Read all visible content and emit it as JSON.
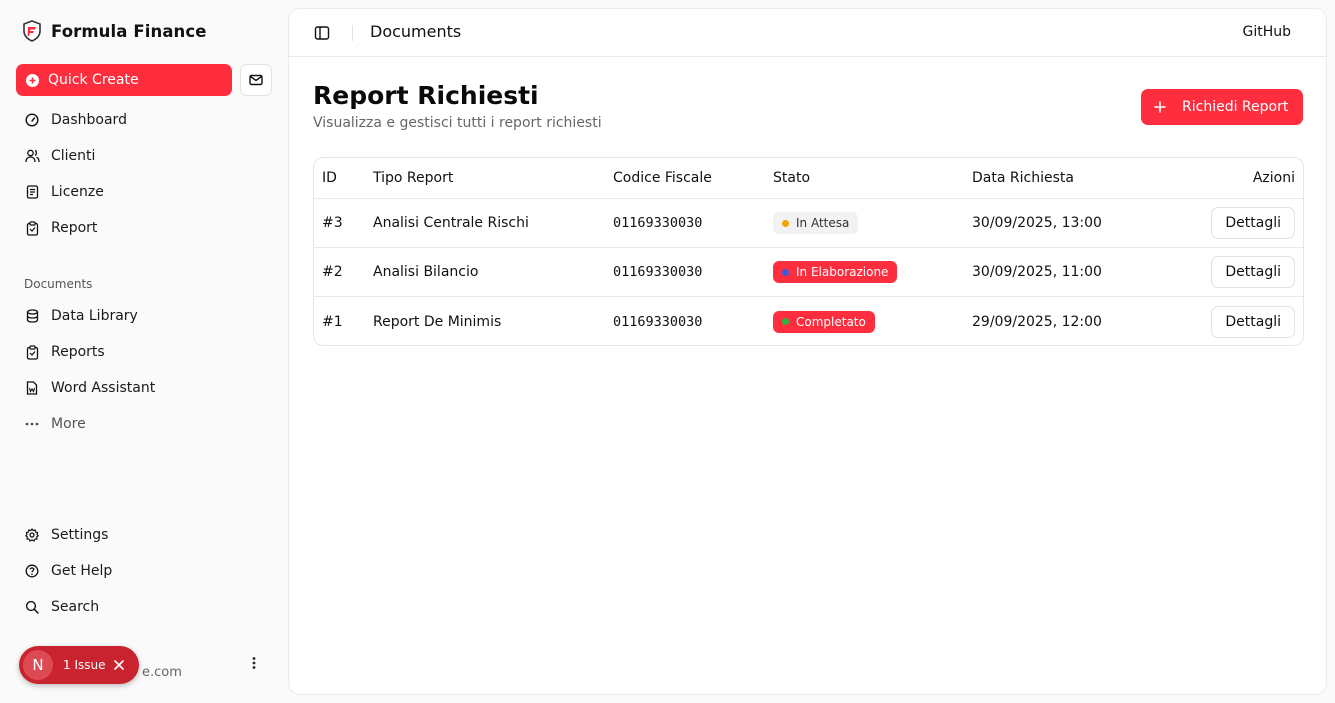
{
  "app": {
    "brand_name": "Formula Finance"
  },
  "colors": {
    "accent": "#ff2e3f",
    "dot_waiting": "#f0a500",
    "dot_processing": "#3b5bdb",
    "dot_done": "#2fb344"
  },
  "sidebar": {
    "quick_create_label": "Quick Create",
    "main_items": [
      {
        "label": "Dashboard",
        "icon": "gauge-icon"
      },
      {
        "label": "Clienti",
        "icon": "users-icon"
      },
      {
        "label": "Licenze",
        "icon": "license-icon"
      },
      {
        "label": "Report",
        "icon": "clipboard-icon"
      }
    ],
    "documents_label": "Documents",
    "document_items": [
      {
        "label": "Data Library",
        "icon": "database-icon"
      },
      {
        "label": "Reports",
        "icon": "clipboard-icon"
      },
      {
        "label": "Word Assistant",
        "icon": "file-word-icon"
      },
      {
        "label": "More",
        "icon": "dots-icon"
      }
    ],
    "bottom_items": [
      {
        "label": "Settings",
        "icon": "gear-icon"
      },
      {
        "label": "Get Help",
        "icon": "help-icon"
      },
      {
        "label": "Search",
        "icon": "search-icon"
      }
    ],
    "user_email_visible": "e.com"
  },
  "issue_badge": {
    "avatar_letter": "N",
    "label": "1 Issue"
  },
  "topbar": {
    "title": "Documents",
    "github_label": "GitHub"
  },
  "page": {
    "title": "Report Richiesti",
    "subtitle": "Visualizza e gestisci tutti i report richiesti",
    "request_button_label": "Richiedi Report"
  },
  "table": {
    "headers": {
      "id": "ID",
      "type": "Tipo Report",
      "cf": "Codice Fiscale",
      "state": "Stato",
      "date": "Data Richiesta",
      "actions": "Azioni"
    },
    "rows": [
      {
        "id": "#3",
        "type": "Analisi Centrale Rischi",
        "cf": "01169330030",
        "state": "In Attesa",
        "date": "30/09/2025, 13:00",
        "action": "Dettagli"
      },
      {
        "id": "#2",
        "type": "Analisi Bilancio",
        "cf": "01169330030",
        "state": "In Elaborazione",
        "date": "30/09/2025, 11:00",
        "action": "Dettagli"
      },
      {
        "id": "#1",
        "type": "Report De Minimis",
        "cf": "01169330030",
        "state": "Completato",
        "date": "29/09/2025, 12:00",
        "action": "Dettagli"
      }
    ]
  }
}
